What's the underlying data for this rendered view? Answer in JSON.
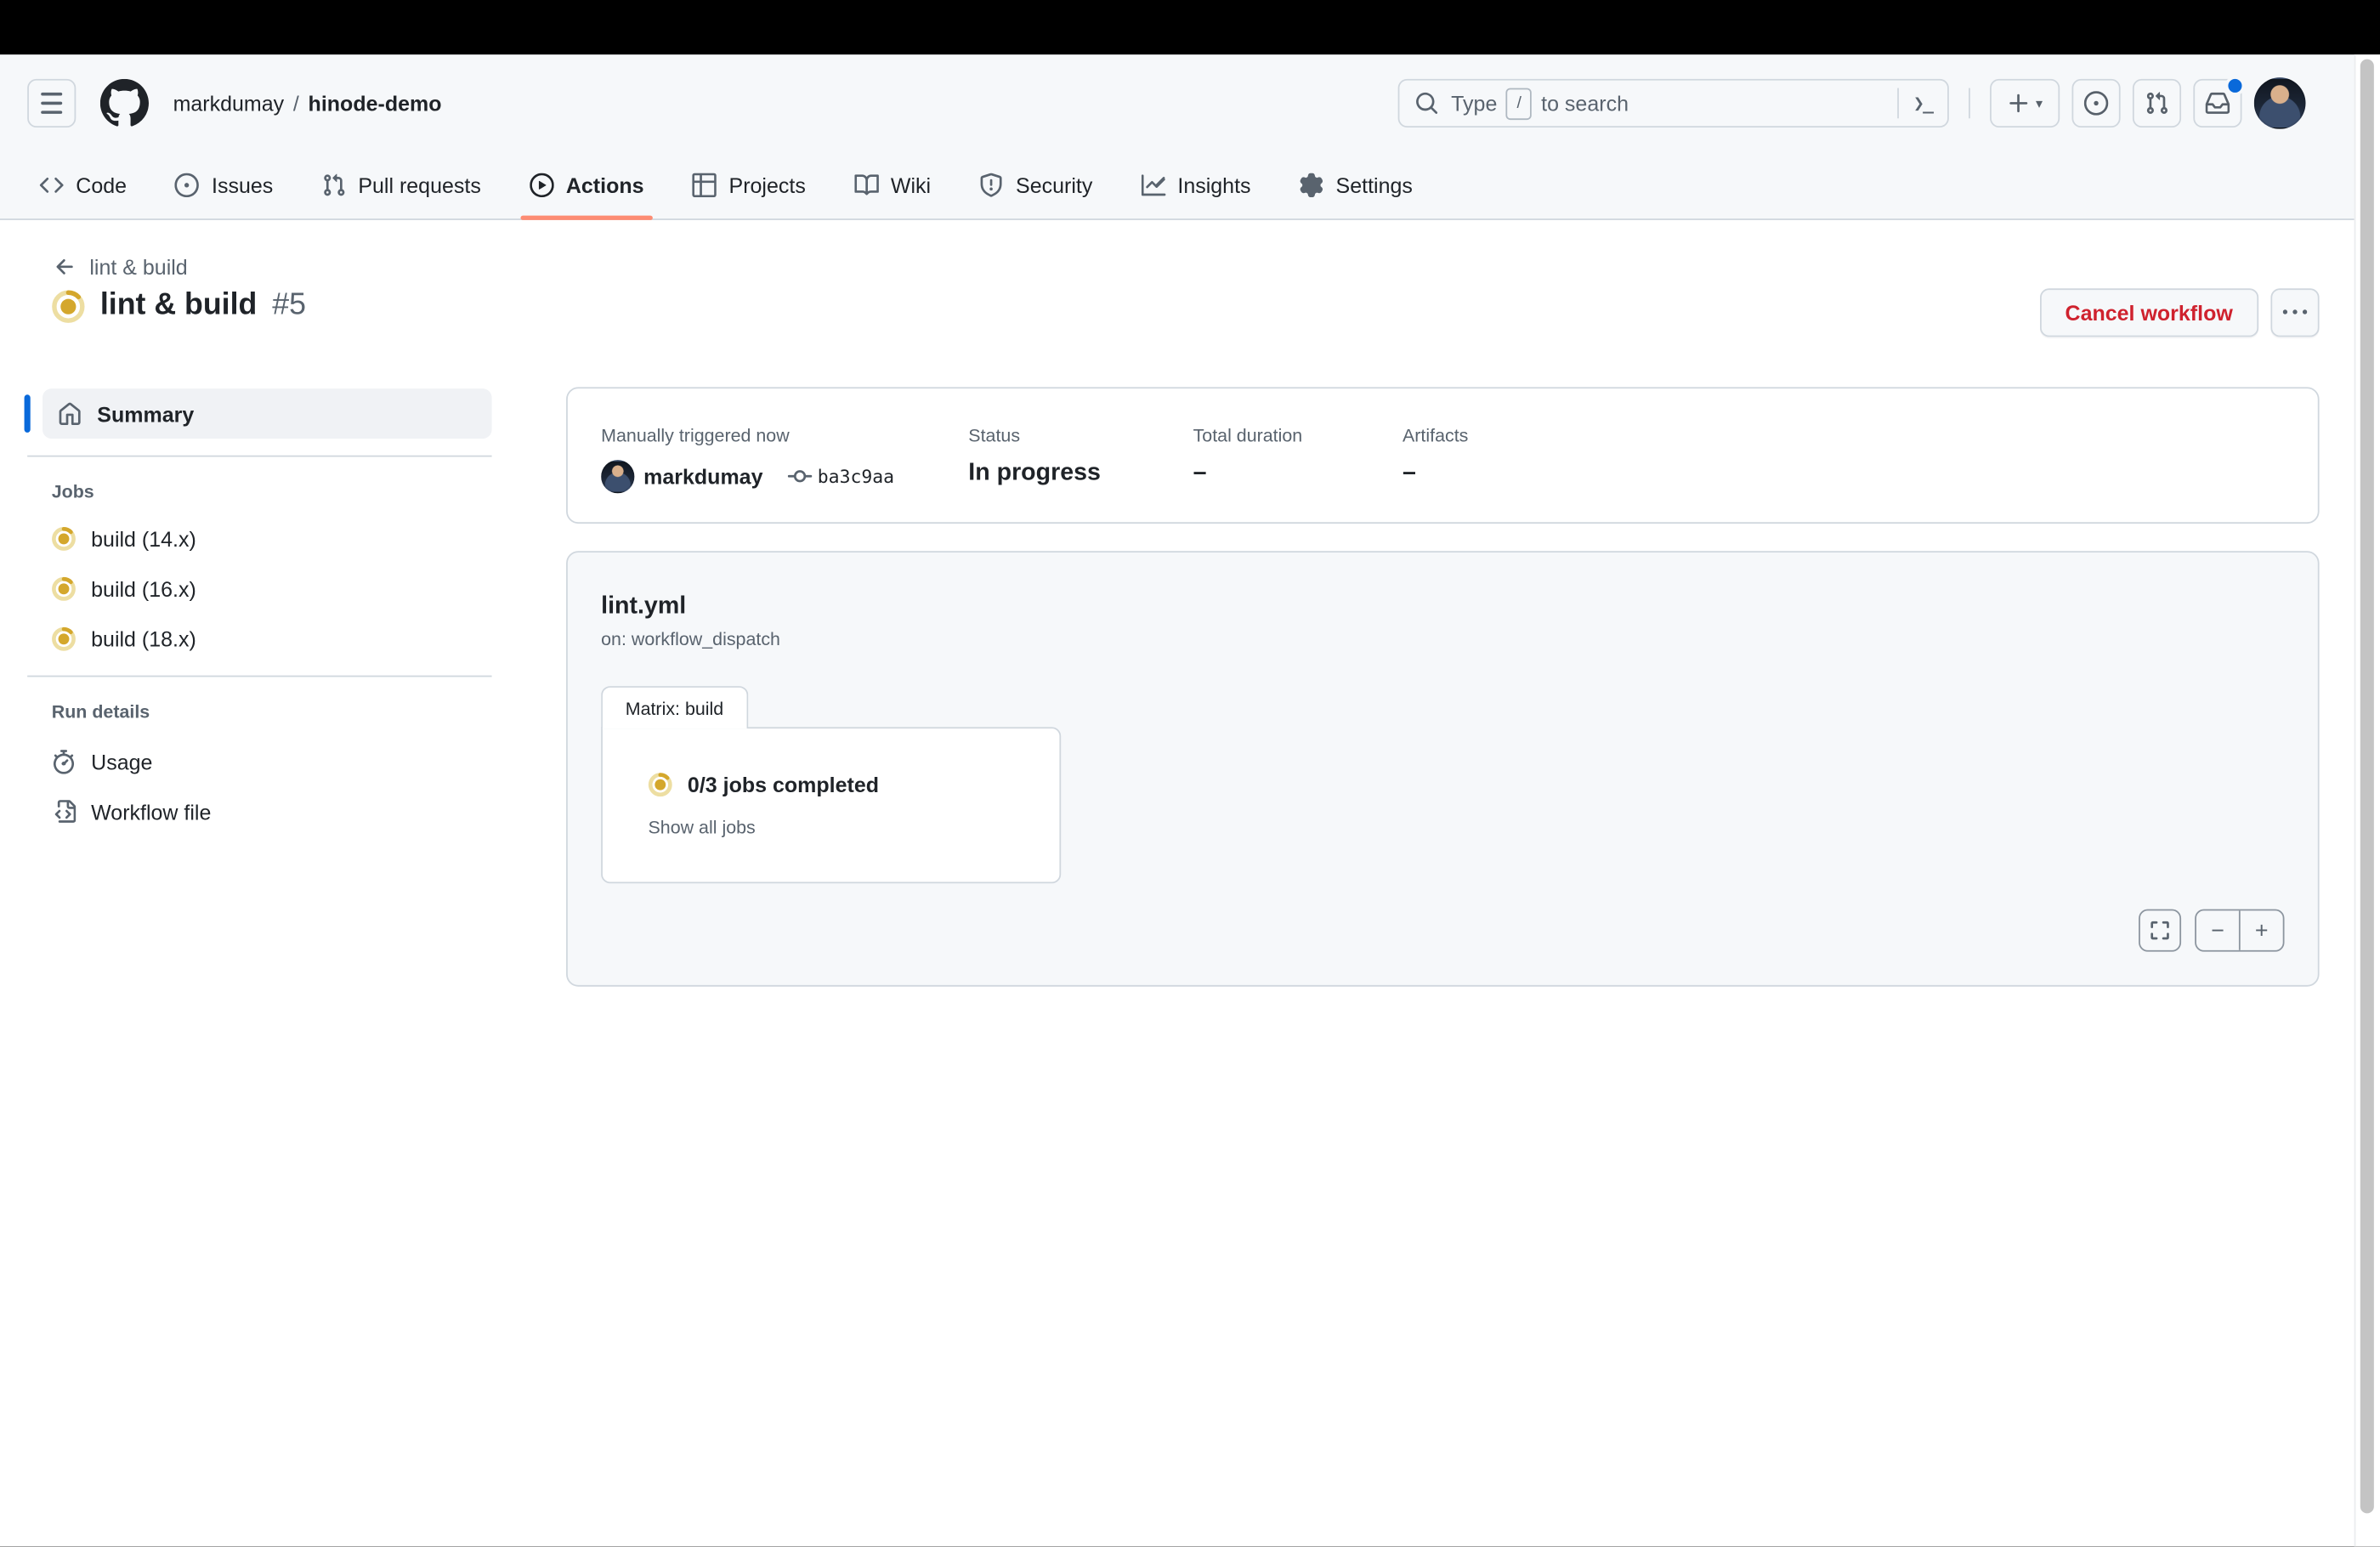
{
  "header": {
    "breadcrumb": {
      "owner": "markdumay",
      "separator": "/",
      "repo": "hinode-demo"
    },
    "search": {
      "prefix": "Type",
      "slash_key": "/",
      "suffix": "to search",
      "terminal_hint": "❯_"
    },
    "new_button_caret": "▾"
  },
  "nav": {
    "tabs": [
      {
        "label": "Code",
        "icon": "code-icon"
      },
      {
        "label": "Issues",
        "icon": "issue-opened-icon"
      },
      {
        "label": "Pull requests",
        "icon": "git-pull-request-icon"
      },
      {
        "label": "Actions",
        "icon": "play-icon",
        "active": true
      },
      {
        "label": "Projects",
        "icon": "table-icon"
      },
      {
        "label": "Wiki",
        "icon": "book-icon"
      },
      {
        "label": "Security",
        "icon": "shield-icon"
      },
      {
        "label": "Insights",
        "icon": "graph-icon"
      },
      {
        "label": "Settings",
        "icon": "gear-icon"
      }
    ]
  },
  "run_header": {
    "back_label": "lint & build",
    "title": "lint & build",
    "run_number": "#5",
    "cancel_label": "Cancel workflow"
  },
  "sidebar": {
    "summary_label": "Summary",
    "jobs_heading": "Jobs",
    "jobs": [
      {
        "label": "build (14.x)"
      },
      {
        "label": "build (16.x)"
      },
      {
        "label": "build (18.x)"
      }
    ],
    "run_details_heading": "Run details",
    "usage_label": "Usage",
    "workflow_file_label": "Workflow file"
  },
  "summary_card": {
    "trigger_label": "Manually triggered now",
    "trigger_user": "markdumay",
    "commit_sha": "ba3c9aa",
    "status_label": "Status",
    "status_value": "In progress",
    "duration_label": "Total duration",
    "duration_value": "–",
    "artifacts_label": "Artifacts",
    "artifacts_value": "–"
  },
  "workflow_graph": {
    "file_name": "lint.yml",
    "trigger": "on: workflow_dispatch",
    "matrix_label": "Matrix: build",
    "jobs_status": "0/3 jobs completed",
    "show_all_label": "Show all jobs",
    "zoom_out": "−",
    "zoom_in": "+"
  },
  "colors": {
    "in_progress_yellow": "#d4a72c",
    "in_progress_ring": "#eddea2",
    "accent_blue": "#0969da",
    "danger_red": "#cf222e",
    "tab_underline": "#fd8c73",
    "header_bg": "#f6f8fa",
    "border": "#d0d7de"
  }
}
